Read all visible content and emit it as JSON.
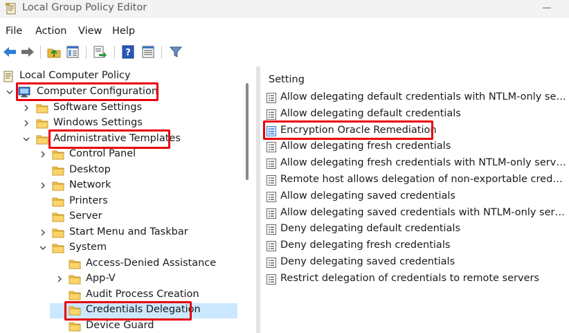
{
  "window": {
    "title": "Local Group Policy Editor"
  },
  "menu": [
    "File",
    "Action",
    "View",
    "Help"
  ],
  "toolbar": [
    "back-arrow-icon",
    "forward-arrow-icon",
    "up-folder-icon",
    "show-hide-tree-icon",
    "export-list-icon",
    "help-icon",
    "properties-view-icon",
    "filter-icon"
  ],
  "tree": [
    {
      "label": "Local Computer Policy",
      "icon": "policy-doc-icon",
      "expanded": true
    },
    {
      "label": "Computer Configuration",
      "icon": "computer-icon",
      "expanded": true
    },
    {
      "label": "Software Settings",
      "icon": "folder-icon",
      "expanded": false
    },
    {
      "label": "Windows Settings",
      "icon": "folder-icon",
      "expanded": false
    },
    {
      "label": "Administrative Templates",
      "icon": "folder-icon",
      "expanded": true
    },
    {
      "label": "Control Panel",
      "icon": "folder-icon",
      "expanded": false
    },
    {
      "label": "Desktop",
      "icon": "folder-icon"
    },
    {
      "label": "Network",
      "icon": "folder-icon",
      "expanded": false
    },
    {
      "label": "Printers",
      "icon": "folder-icon"
    },
    {
      "label": "Server",
      "icon": "folder-icon"
    },
    {
      "label": "Start Menu and Taskbar",
      "icon": "folder-icon",
      "expanded": false
    },
    {
      "label": "System",
      "icon": "folder-icon",
      "expanded": true
    },
    {
      "label": "Access-Denied Assistance",
      "icon": "folder-icon"
    },
    {
      "label": "App-V",
      "icon": "folder-icon",
      "expanded": false
    },
    {
      "label": "Audit Process Creation",
      "icon": "folder-icon"
    },
    {
      "label": "Credentials Delegation",
      "icon": "folder-open-icon",
      "selected": true
    },
    {
      "label": "Device Guard",
      "icon": "folder-icon"
    }
  ],
  "settings": {
    "column_header": "Setting",
    "items": [
      "Allow delegating default credentials with NTLM-only server a...",
      "Allow delegating default credentials",
      "Encryption Oracle Remediation",
      "Allow delegating fresh credentials",
      "Allow delegating fresh credentials with NTLM-only server aut...",
      "Remote host allows delegation of non-exportable credentials",
      "Allow delegating saved credentials",
      "Allow delegating saved credentials with NTLM-only server au...",
      "Deny delegating default credentials",
      "Deny delegating fresh credentials",
      "Deny delegating saved credentials",
      "Restrict delegation of credentials to remote servers"
    ]
  },
  "colors": {
    "highlight": "#e8000b",
    "folder": "#f4c44a",
    "selected_row": "#cce8ff"
  }
}
